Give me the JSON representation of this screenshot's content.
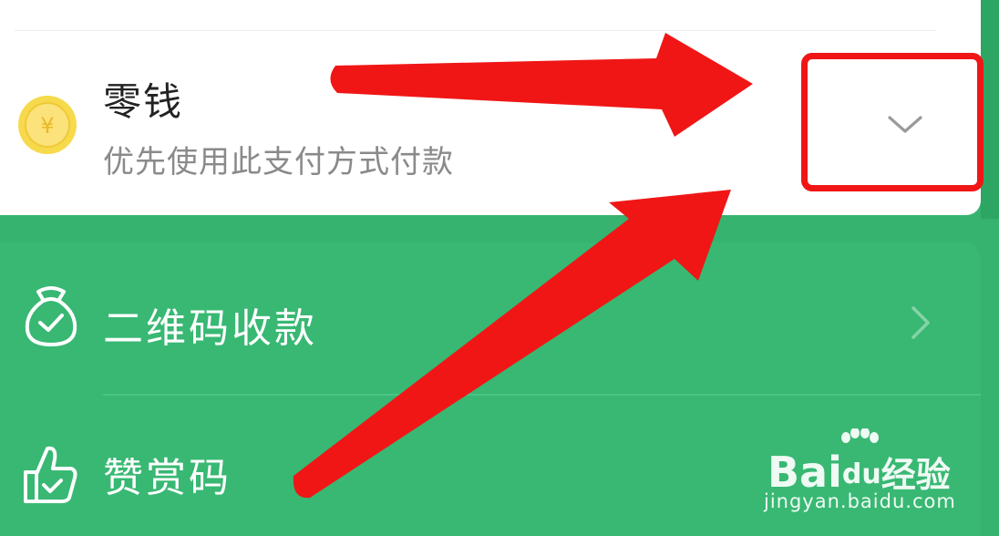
{
  "payment_method": {
    "title": "零钱",
    "subtitle": "优先使用此支付方式付款",
    "coin_symbol": "¥",
    "expand_icon": "chevron-down-icon"
  },
  "menu": {
    "items": [
      {
        "label": "二维码收款",
        "icon": "money-bag-icon",
        "trailing_icon": "chevron-right-icon"
      },
      {
        "label": "赞赏码",
        "icon": "thumbs-up-icon",
        "trailing_icon": "chevron-right-icon"
      }
    ]
  },
  "annotations": {
    "arrow_color": "#f01616",
    "highlight_color": "#f01616"
  },
  "watermark": {
    "brand_part1": "Bai",
    "brand_part2": "du",
    "brand_part3": "经验",
    "url": "jingyan.baidu.com"
  },
  "colors": {
    "brand_green": "#36b36e",
    "card_white": "#ffffff",
    "coin_yellow": "#f7d94c"
  }
}
